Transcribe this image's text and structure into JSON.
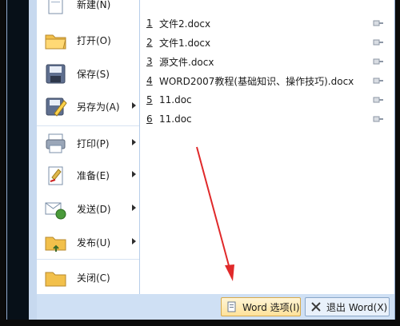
{
  "left_menu": [
    {
      "label": "新建(N)",
      "has_submenu": false
    },
    {
      "label": "打开(O)",
      "has_submenu": false
    },
    {
      "label": "保存(S)",
      "has_submenu": false
    },
    {
      "label": "另存为(A)",
      "has_submenu": true
    },
    {
      "label": "打印(P)",
      "has_submenu": true
    },
    {
      "label": "准备(E)",
      "has_submenu": true
    },
    {
      "label": "发送(D)",
      "has_submenu": true
    },
    {
      "label": "发布(U)",
      "has_submenu": true
    },
    {
      "label": "关闭(C)",
      "has_submenu": false
    }
  ],
  "recent_documents": [
    {
      "index": "1",
      "name": "文件2.docx"
    },
    {
      "index": "2",
      "name": "文件1.docx"
    },
    {
      "index": "3",
      "name": "源文件.docx"
    },
    {
      "index": "4",
      "name": "WORD2007教程(基础知识、操作技巧).docx"
    },
    {
      "index": "5",
      "name": "11.doc"
    },
    {
      "index": "6",
      "name": "11.doc"
    }
  ],
  "footer": {
    "word_options_label": "Word 选项(I)",
    "exit_word_label": "退出 Word(X)"
  },
  "colors": {
    "accent_blue": "#c7d9ef",
    "highlight_yellow": "#ffe29a",
    "annotation_red": "#e0292a"
  }
}
